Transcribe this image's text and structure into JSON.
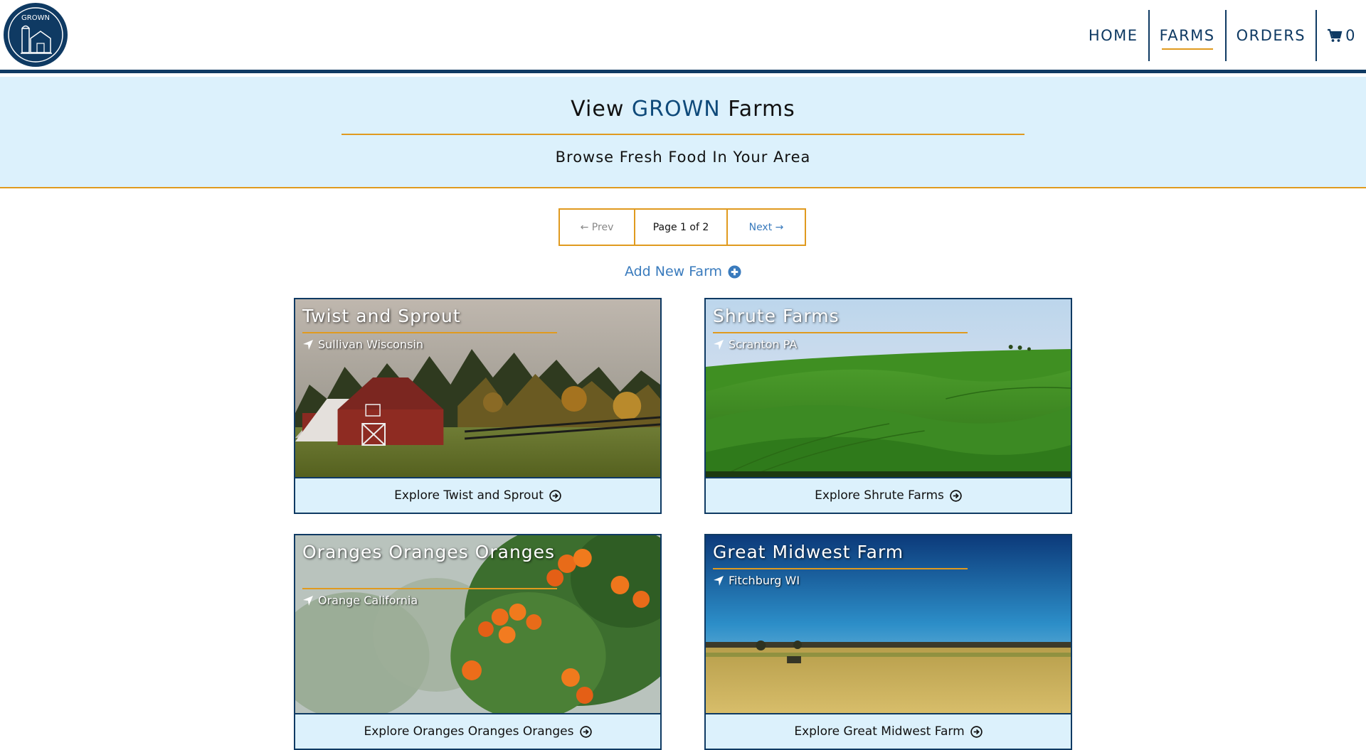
{
  "nav": {
    "logo_text": "GROWN",
    "items": [
      {
        "label": "HOME"
      },
      {
        "label": "FARMS"
      },
      {
        "label": "ORDERS"
      }
    ],
    "cart_count": "0"
  },
  "hero": {
    "title_prefix": "View ",
    "title_brand": "GROWN",
    "title_suffix": " Farms",
    "subtitle": "Browse Fresh Food In Your Area"
  },
  "pager": {
    "prev_label": "← Prev",
    "info": "Page 1 of 2",
    "next_label": "Next →"
  },
  "add_farm_label": "Add New Farm",
  "farms": [
    {
      "name": "Twist and Sprout",
      "location": "Sullivan Wisconsin",
      "explore": "Explore Twist and Sprout"
    },
    {
      "name": "Shrute Farms",
      "location": "Scranton PA",
      "explore": "Explore Shrute Farms"
    },
    {
      "name": "Oranges Oranges Oranges",
      "location": "Orange California",
      "explore": "Explore Oranges Oranges Oranges"
    },
    {
      "name": "Great Midwest Farm",
      "location": "Fitchburg WI",
      "explore": "Explore Great Midwest Farm"
    }
  ],
  "colors": {
    "brand_navy": "#0f3a63",
    "accent_orange": "#e09a1f",
    "hero_bg": "#dcf1fc",
    "link_blue": "#3a7bbd"
  }
}
